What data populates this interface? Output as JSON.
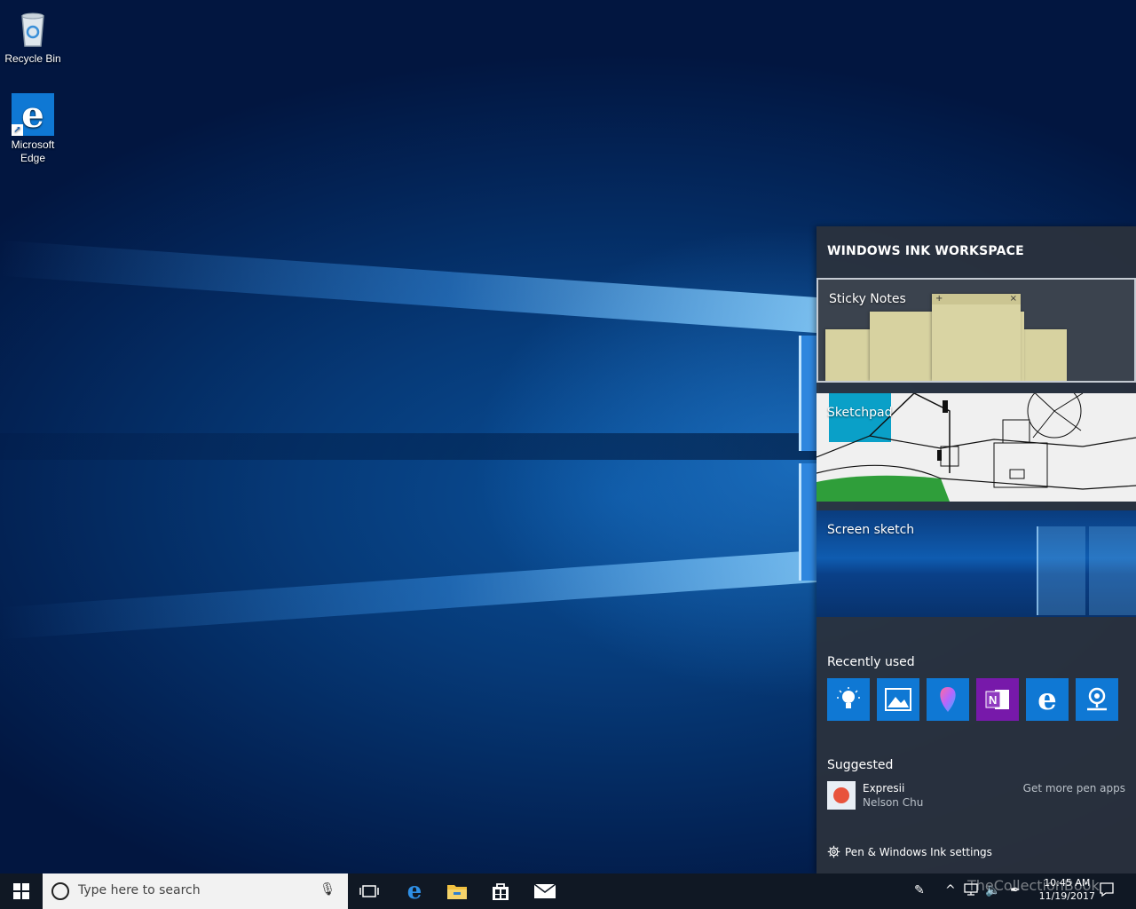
{
  "desktop": {
    "icons": [
      {
        "label": "Recycle Bin",
        "icon": "recycle-bin-icon"
      },
      {
        "label": "Microsoft Edge",
        "icon": "edge-icon"
      }
    ]
  },
  "ink_workspace": {
    "title": "WINDOWS INK WORKSPACE",
    "cards": {
      "sticky_notes": "Sticky Notes",
      "sketchpad": "Sketchpad",
      "screen_sketch": "Screen sketch"
    },
    "recently_used": {
      "heading": "Recently used",
      "apps": [
        {
          "icon": "lightbulb-icon",
          "color": "#0f78d4"
        },
        {
          "icon": "photos-icon",
          "color": "#0f78d4"
        },
        {
          "icon": "paint-3d-icon",
          "color": "#0f78d4"
        },
        {
          "icon": "onenote-icon",
          "color": "#7719aa"
        },
        {
          "icon": "edge-icon",
          "color": "#0f78d4"
        },
        {
          "icon": "maps-icon",
          "color": "#0f78d4"
        }
      ]
    },
    "suggested": {
      "heading": "Suggested",
      "app_name": "Expresii",
      "app_author": "Nelson Chu",
      "more_link": "Get more pen apps"
    },
    "settings_link": "Pen & Windows Ink settings"
  },
  "taskbar": {
    "search_placeholder": "Type here to search",
    "clock_time": "10:45 AM",
    "clock_date": "11/19/2017",
    "watermark": "TheCollectionBook"
  }
}
